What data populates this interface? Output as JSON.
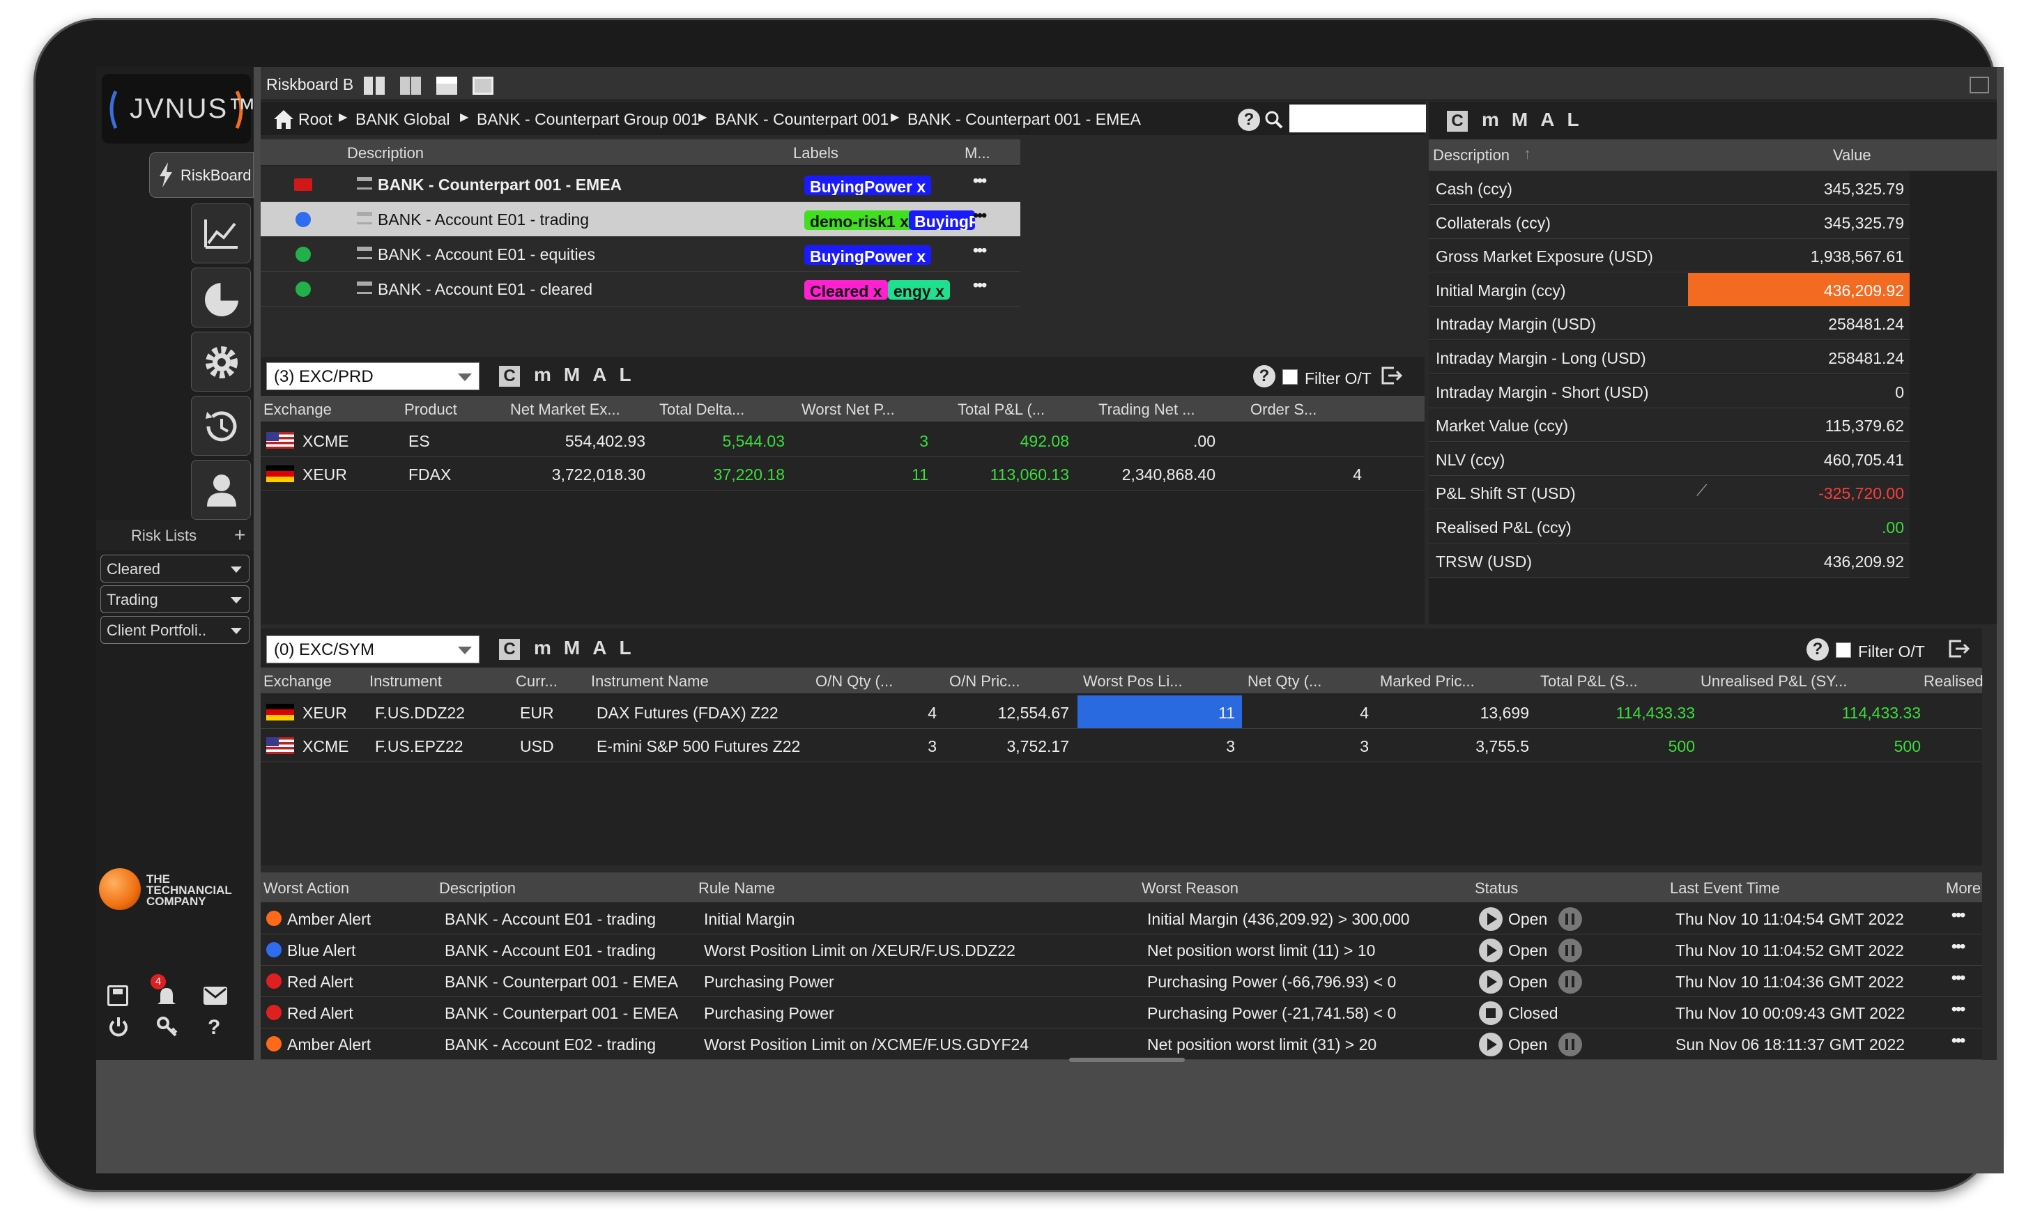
{
  "app": {
    "logo": "JVNUS™",
    "company": "THE TECHNANCIAL COMPANY",
    "window_title": "Riskboard B",
    "nav_riskboard": "RiskBoard",
    "risk_lists_label": "Risk Lists",
    "risk_lists": [
      "Cleared",
      "Trading",
      "Client Portfoli.."
    ],
    "notif_count": "4"
  },
  "breadcrumb": [
    "Root",
    "BANK Global",
    "BANK - Counterpart Group 001",
    "BANK - Counterpart 001",
    "BANK - Counterpart 001 - EMEA"
  ],
  "cmmal": [
    "m",
    "M",
    "A",
    "L"
  ],
  "tree": {
    "headers": [
      "Description",
      "Labels",
      "M..."
    ],
    "rows": [
      {
        "desc": "BANK - Counterpart 001 - EMEA",
        "labels": [
          {
            "text": "BuyingPower x",
            "color": "#1a1aff"
          }
        ],
        "status": "folder"
      },
      {
        "desc": "BANK - Account E01 - trading",
        "labels": [
          {
            "text": "demo-risk1 x",
            "color": "#40e020"
          },
          {
            "text": "BuyingPow",
            "color": "#1a1aff"
          }
        ],
        "status": "#2e6cf0"
      },
      {
        "desc": "BANK - Account E01 - equities",
        "labels": [
          {
            "text": "BuyingPower x",
            "color": "#1a1aff"
          }
        ],
        "status": "#22b04a"
      },
      {
        "desc": "BANK - Account E01 - cleared",
        "labels": [
          {
            "text": "Cleared x",
            "color": "#ff20d0"
          },
          {
            "text": "engy x",
            "color": "#20e090"
          }
        ],
        "status": "#22b04a"
      }
    ]
  },
  "metrics": {
    "headers": [
      "Description",
      "Value"
    ],
    "rows": [
      {
        "d": "Cash (ccy)",
        "v": "345,325.79"
      },
      {
        "d": "Collaterals (ccy)",
        "v": "345,325.79"
      },
      {
        "d": "Gross Market Exposure (USD)",
        "v": "1,938,567.61"
      },
      {
        "d": "Initial Margin (ccy)",
        "v": "436,209.92",
        "hl": true
      },
      {
        "d": "Intraday Margin (USD)",
        "v": "258481.24"
      },
      {
        "d": "Intraday Margin - Long (USD)",
        "v": "258481.24"
      },
      {
        "d": "Intraday Margin - Short (USD)",
        "v": "0"
      },
      {
        "d": "Market Value (ccy)",
        "v": "115,379.62"
      },
      {
        "d": "NLV (ccy)",
        "v": "460,705.41"
      },
      {
        "d": "P&L Shift ST (USD)",
        "v": "-325,720.00",
        "red": true,
        "chart": true
      },
      {
        "d": "Realised P&L (ccy)",
        "v": ".00",
        "green": true
      },
      {
        "d": "TRSW (USD)",
        "v": "436,209.92"
      }
    ]
  },
  "prd": {
    "select": "(3) EXC/PRD",
    "filter": "Filter O/T",
    "headers": [
      "Exchange",
      "Product",
      "Net Market Ex...",
      "Total Delta...",
      "Worst Net P...",
      "Total P&L (...",
      "Trading Net ...",
      "Order S..."
    ],
    "rows": [
      {
        "flag": "us",
        "ex": "XCME",
        "prod": "ES",
        "nme": "554,402.93",
        "td": "5,544.03",
        "wnp": "3",
        "pl": "492.08",
        "tn": ".00",
        "os": ""
      },
      {
        "flag": "de",
        "ex": "XEUR",
        "prod": "FDAX",
        "nme": "3,722,018.30",
        "td": "37,220.18",
        "wnp": "11",
        "pl": "113,060.13",
        "tn": "2,340,868.40",
        "os": "4"
      }
    ]
  },
  "sym": {
    "select": "(0) EXC/SYM",
    "filter": "Filter O/T",
    "headers": [
      "Exchange",
      "Instrument",
      "Curr...",
      "Instrument Name",
      "O/N Qty (...",
      "O/N Pric...",
      "Worst Pos Li...",
      "Net Qty (...",
      "Marked Pric...",
      "Total P&L (S...",
      "Unrealised P&L (SY...",
      "Realised"
    ],
    "rows": [
      {
        "flag": "de",
        "ex": "XEUR",
        "inst": "F.US.DDZ22",
        "cur": "EUR",
        "name": "DAX Futures (FDAX) Z22",
        "onq": "4",
        "onp": "12,554.67",
        "wpl": "11",
        "nq": "4",
        "mp": "13,699",
        "tpl": "114,433.33",
        "upl": "114,433.33",
        "hl": true
      },
      {
        "flag": "us",
        "ex": "XCME",
        "inst": "F.US.EPZ22",
        "cur": "USD",
        "name": "E-mini S&P 500 Futures Z22",
        "onq": "3",
        "onp": "3,752.17",
        "wpl": "3",
        "nq": "3",
        "mp": "3,755.5",
        "tpl": "500",
        "upl": "500"
      }
    ]
  },
  "alerts": {
    "headers": [
      "Worst Action",
      "Description",
      "Rule Name",
      "Worst Reason",
      "Status",
      "Last Event Time",
      "More"
    ],
    "rows": [
      {
        "color": "#ff6a1a",
        "action": "Amber Alert",
        "desc": "BANK - Account E01 - trading",
        "rule": "Initial Margin",
        "reason": "Initial Margin (436,209.92) > 300,000",
        "status": "Open",
        "time": "Thu Nov 10 11:04:54 GMT 2022"
      },
      {
        "color": "#2e6cf0",
        "action": "Blue Alert",
        "desc": "BANK - Account E01 - trading",
        "rule": "Worst Position Limit on /XEUR/F.US.DDZ22",
        "reason": "Net position worst limit (11) > 10",
        "status": "Open",
        "time": "Thu Nov 10 11:04:52 GMT 2022"
      },
      {
        "color": "#e02020",
        "action": "Red Alert",
        "desc": "BANK - Counterpart 001 - EMEA",
        "rule": "Purchasing Power",
        "reason": "Purchasing Power (-66,796.93) < 0",
        "status": "Open",
        "time": "Thu Nov 10 11:04:36 GMT 2022"
      },
      {
        "color": "#e02020",
        "action": "Red Alert",
        "desc": "BANK - Counterpart 001 - EMEA",
        "rule": "Purchasing Power",
        "reason": "Purchasing Power (-21,741.58) < 0",
        "status": "Closed",
        "time": "Thu Nov 10 00:09:43 GMT 2022"
      },
      {
        "color": "#ff6a1a",
        "action": "Amber Alert",
        "desc": "BANK - Account E02 - trading",
        "rule": "Worst Position Limit on /XCME/F.US.GDYF24",
        "reason": "Net position worst limit (31) > 20",
        "status": "Open",
        "time": "Sun Nov 06 18:11:37 GMT 2022"
      }
    ]
  }
}
